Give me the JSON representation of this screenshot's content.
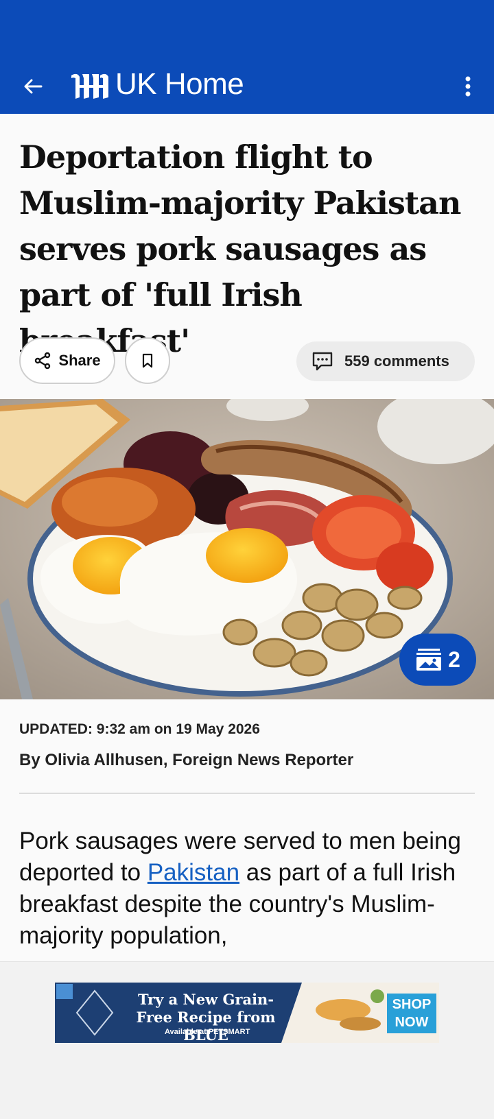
{
  "app_bar": {
    "title": "UK Home",
    "back_icon": "arrow-left-icon",
    "more_icon": "more-vertical-icon",
    "logo_icon": "dm-logo-icon"
  },
  "article": {
    "headline": "Deportation flight to Muslim-majority Pakistan serves pork sausages as part of 'full Irish breakfast'",
    "share_label": "Share",
    "comments_label": "559 comments",
    "gallery_count": "2",
    "updated": "UPDATED: 9:32 am on 19 May 2026",
    "byline": "By Olivia Allhusen, Foreign News Reporter",
    "body_before_link": "Pork sausages were served to men being deported to ",
    "body_link": "Pakistan",
    "body_after_link": " as part of a full Irish breakfast despite the country's Muslim-majority population,"
  },
  "ad": {
    "headline": "Try a New Grain-Free Recipe from BLUE",
    "sub": "Available at PETSMART",
    "cta": "SHOP NOW"
  },
  "colors": {
    "brand_blue": "#0c4bb8",
    "link_blue": "#1660c2"
  }
}
